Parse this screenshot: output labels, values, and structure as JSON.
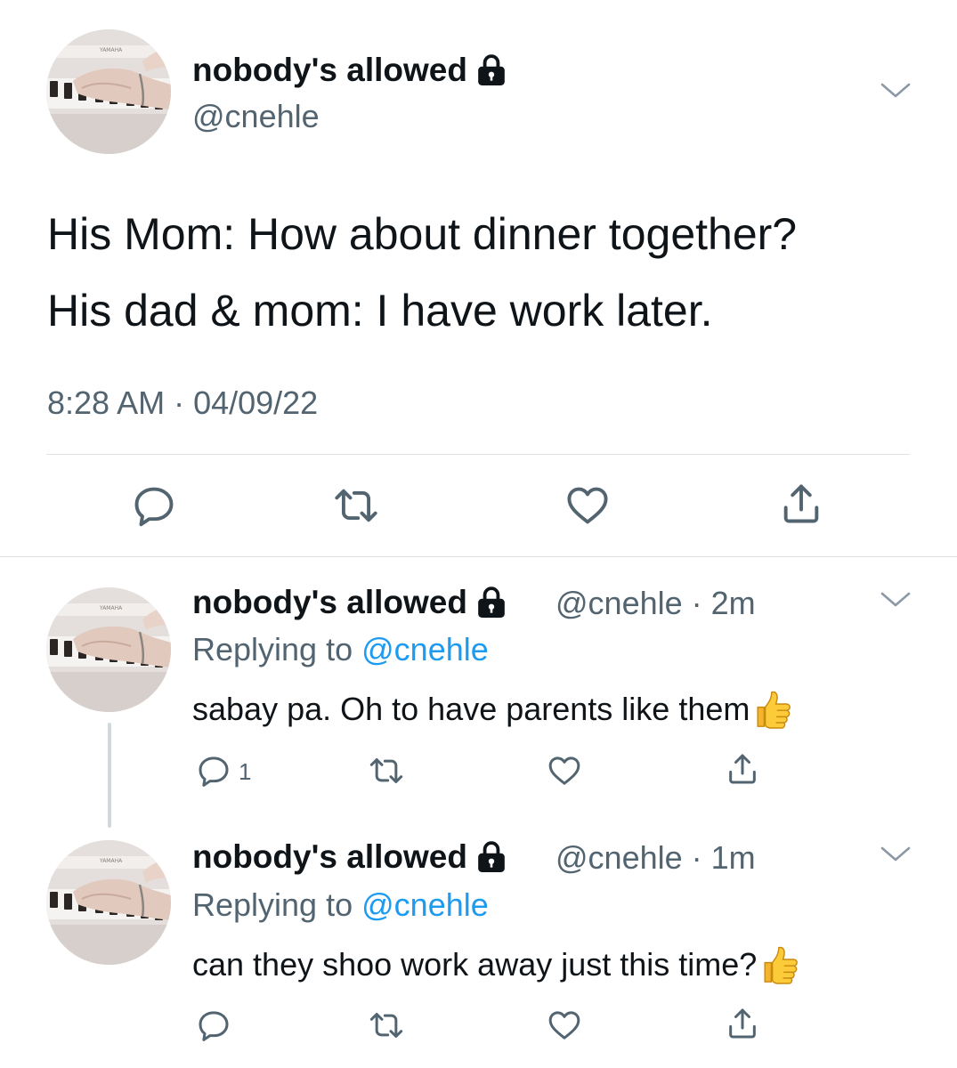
{
  "main_tweet": {
    "display_name": "nobody's allowed",
    "handle": "@cnehle",
    "text": "His Mom: How about dinner together?\nHis dad & mom: I have work later.",
    "timestamp": "8:28 AM · 04/09/22"
  },
  "replies": [
    {
      "display_name": "nobody's allowed",
      "handle": "@cnehle",
      "time": "2m",
      "replying_label": "Replying to",
      "replying_to": "@cnehle",
      "text": "sabay pa. Oh to have parents like them",
      "reply_count": "1"
    },
    {
      "display_name": "nobody's allowed",
      "handle": "@cnehle",
      "time": "1m",
      "replying_label": "Replying to",
      "replying_to": "@cnehle",
      "text": "can they shoo work away just this time?",
      "reply_count": ""
    }
  ],
  "colors": {
    "text": "#0f1419",
    "secondary": "#536471",
    "accent": "#1d9bf0",
    "divider": "#dfe3e6"
  },
  "icons": [
    "lock-icon",
    "chevron-down-icon",
    "reply-icon",
    "retweet-icon",
    "like-icon",
    "share-icon",
    "thumbs-up-emoji"
  ]
}
